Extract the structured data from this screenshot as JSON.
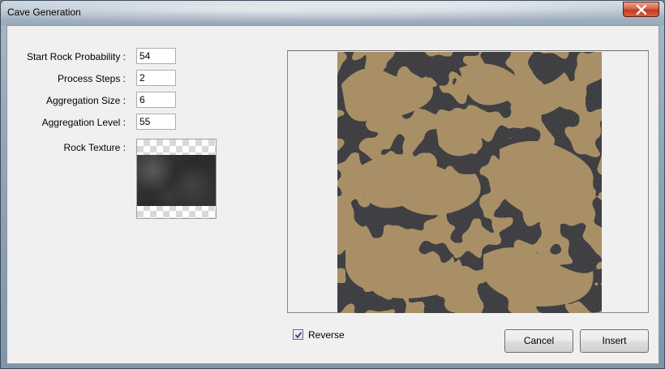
{
  "window": {
    "title": "Cave Generation"
  },
  "fields": [
    {
      "label": "Start Rock Probability :",
      "value": "54"
    },
    {
      "label": "Process Steps :",
      "value": "2"
    },
    {
      "label": "Aggregation Size :",
      "value": "6"
    },
    {
      "label": "Aggregation Level :",
      "value": "55"
    }
  ],
  "rock_texture": {
    "label": "Rock Texture :"
  },
  "reverse": {
    "label": "Reverse",
    "checked": true
  },
  "buttons": {
    "cancel": "Cancel",
    "insert": "Insert"
  },
  "colors": {
    "rock": "#2f2f33",
    "floor": "#a88f66",
    "close": "#c94a30"
  },
  "icons": {
    "close": "close-icon",
    "check": "checkmark-icon"
  }
}
